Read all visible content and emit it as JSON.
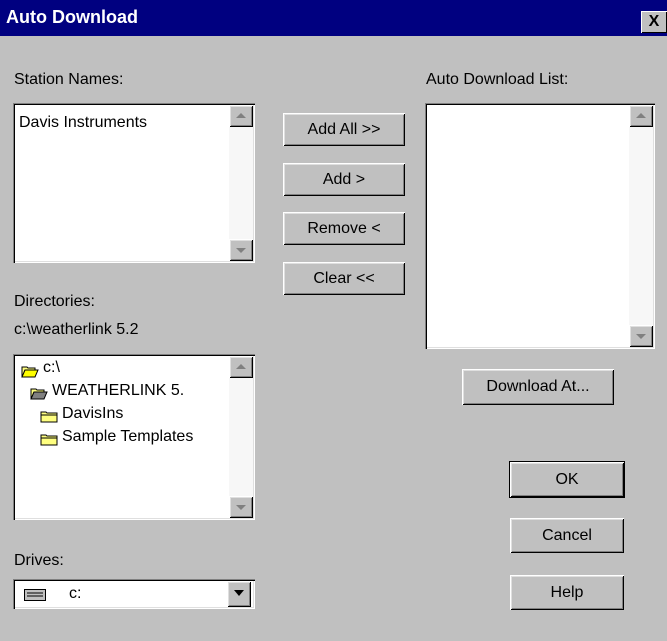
{
  "window": {
    "title": "Auto Download",
    "close_glyph": "X"
  },
  "station_names": {
    "label": "Station Names:",
    "items": [
      "Davis Instruments"
    ]
  },
  "auto_download_list": {
    "label": "Auto Download List:",
    "items": []
  },
  "directories": {
    "label": "Directories:",
    "current_path": "c:\\weatherlink 5.2",
    "items": [
      {
        "label": "c:\\",
        "icon": "open-folder-icon"
      },
      {
        "label": "WEATHERLINK 5.",
        "icon": "open-folder-icon"
      },
      {
        "label": "DavisIns",
        "icon": "folder-icon"
      },
      {
        "label": "Sample Templates",
        "icon": "folder-icon"
      }
    ]
  },
  "drives": {
    "label": "Drives:",
    "selected": "c:",
    "icon": "drive-icon"
  },
  "buttons": {
    "add_all": "Add All >>",
    "add": "Add >",
    "remove": "Remove <",
    "clear": "Clear <<",
    "download_at": "Download At...",
    "ok": "OK",
    "cancel": "Cancel",
    "help": "Help"
  },
  "colors": {
    "title_bar": "#000080",
    "face": "#c0c0c0",
    "window_bg": "#ffffff"
  }
}
